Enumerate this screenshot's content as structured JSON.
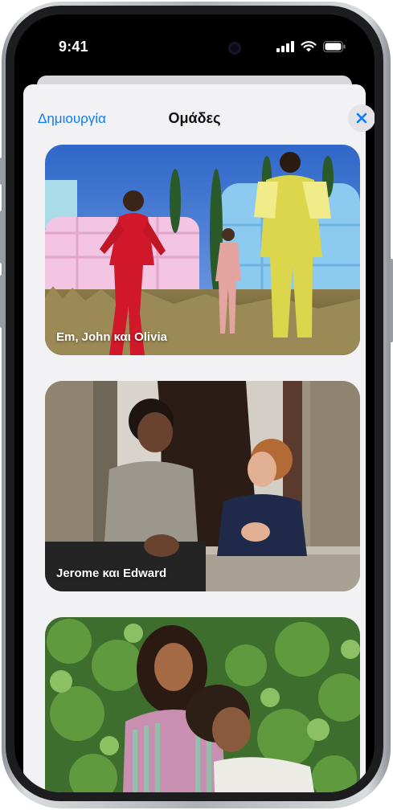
{
  "status_bar": {
    "time": "9:41"
  },
  "sheet": {
    "create_label": "Δημιουργία",
    "title": "Ομάδες",
    "close_icon": "close-icon"
  },
  "groups": [
    {
      "label": "Em, John και Olivia"
    },
    {
      "label": "Jerome και Edward"
    },
    {
      "label": ""
    }
  ],
  "colors": {
    "accent": "#0a7bff",
    "sheet_bg": "#f2f2f4"
  }
}
